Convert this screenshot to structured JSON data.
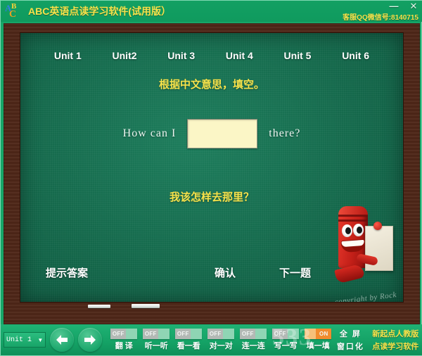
{
  "window": {
    "title": "ABC英语点读学习软件(试用版）",
    "logo_letters": [
      "A",
      "B",
      "C"
    ],
    "contact": "客服QQ微信号:8140715",
    "minimize_label": "—",
    "close_label": "✕"
  },
  "units": [
    {
      "label": "Unit 1"
    },
    {
      "label": "Unit2"
    },
    {
      "label": "Unit 3"
    },
    {
      "label": "Unit 4"
    },
    {
      "label": "Unit 5"
    },
    {
      "label": "Unit 6"
    }
  ],
  "board": {
    "prompt": "根据中文意思，填空。",
    "sentence_before": "How can I",
    "sentence_after": "there?",
    "answer_value": "",
    "answer_placeholder": "",
    "translation": "我该怎样去那里？",
    "buttons": {
      "hint": "提示答案",
      "confirm": "确认",
      "next": "下一题"
    },
    "copyright": "copyright by Rock"
  },
  "toolbar": {
    "unit_select_value": "Unit 1",
    "prev_label": "◀",
    "next_label": "▶",
    "toggles": [
      {
        "label": "翻 译",
        "state": "OFF",
        "on": false
      },
      {
        "label": "听一听",
        "state": "OFF",
        "on": false
      },
      {
        "label": "看一看",
        "state": "OFF",
        "on": false
      },
      {
        "label": "对一对",
        "state": "OFF",
        "on": false
      },
      {
        "label": "连一连",
        "state": "OFF",
        "on": false
      },
      {
        "label": "写一写",
        "state": "OFF",
        "on": false
      },
      {
        "label": "填一填",
        "state": "ON",
        "on": true
      }
    ],
    "fullscreen_line1": "全 屏",
    "fullscreen_line2": "窗口化",
    "promo_line1": "新起点人教版",
    "promo_line2": "点读学习软件",
    "watermark": "533"
  },
  "colors": {
    "title_text": "#f7e24a",
    "header_bg": "#13a063",
    "board_green": "#14674a",
    "frame_wood": "#4f2718",
    "answer_box": "#fbf6c6",
    "toggle_on": "#f08c2e",
    "toggle_off": "#b3b9b5"
  }
}
